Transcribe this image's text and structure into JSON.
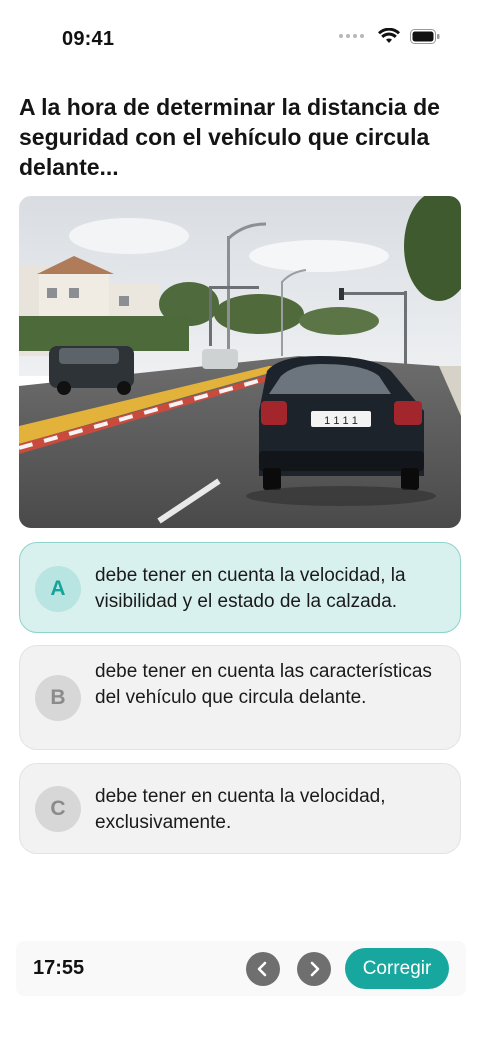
{
  "status_bar": {
    "time": "09:41",
    "icons": [
      "signal-dots-icon",
      "wifi-icon",
      "battery-icon"
    ]
  },
  "question": {
    "text": "A la hora de determinar la distancia de seguridad con el vehículo que circula delante..."
  },
  "image": {
    "description_icon": "road-photo",
    "plate_text": "1 1 1 1"
  },
  "options": [
    {
      "letter": "A",
      "text": "debe tener en cuenta la velocidad, la visibilidad y el estado de la calzada.",
      "selected": true
    },
    {
      "letter": "B",
      "text": "debe tener en cuenta las características del vehículo que circula delante.",
      "selected": false
    },
    {
      "letter": "C",
      "text": "debe tener en cuenta la velocidad, exclusivamente.",
      "selected": false
    }
  ],
  "footer": {
    "timer": "17:55",
    "prev_icon": "chevron-left-icon",
    "next_icon": "chevron-right-icon",
    "correct_label": "Corregir"
  },
  "colors": {
    "accent": "#17a79e",
    "selected_bg": "#d8f1ef",
    "option_bg": "#f2f2f2"
  }
}
